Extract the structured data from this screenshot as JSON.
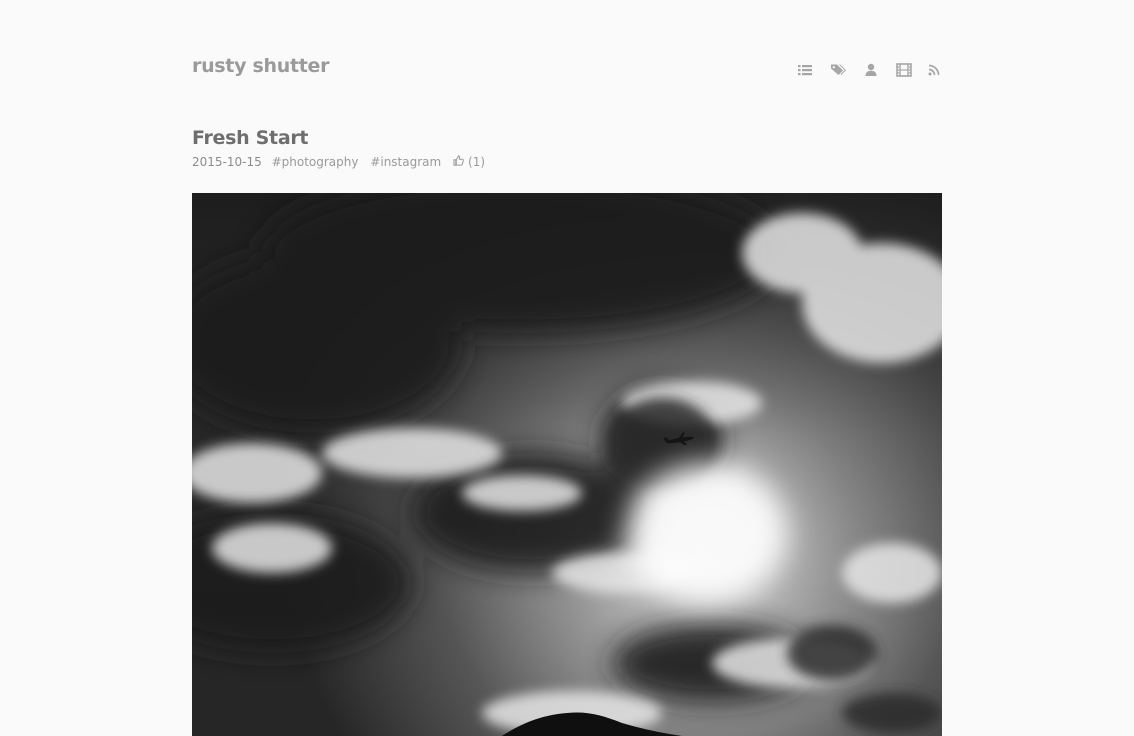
{
  "site": {
    "title": "rusty shutter",
    "nav": [
      {
        "icon": "list-icon"
      },
      {
        "icon": "tags-icon"
      },
      {
        "icon": "user-icon"
      },
      {
        "icon": "film-icon"
      },
      {
        "icon": "rss-icon"
      }
    ]
  },
  "post": {
    "title": "Fresh Start",
    "date": "2015-10-15",
    "tags": [
      "#photography",
      "#instagram"
    ],
    "likes": "(1)",
    "image_alt": "Black and white photo of a cloudy sky with an airplane flying in front of the sun above a mountain ridge"
  },
  "colors": {
    "background": "#fafafa",
    "site_title": "#9a9a9a",
    "post_title": "#6e6e6e",
    "meta": "#8c8c8c",
    "icon": "#a6a6a6"
  }
}
